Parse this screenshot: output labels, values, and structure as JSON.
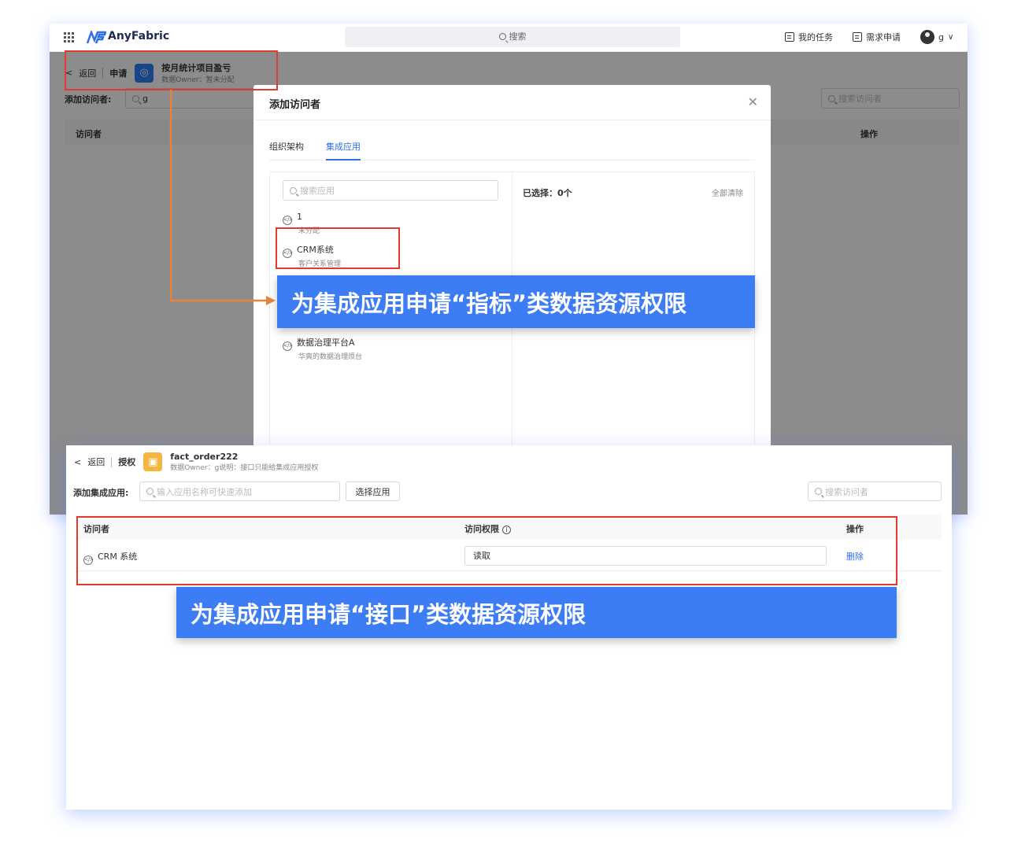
{
  "top": {
    "app_name": "AnyFabric",
    "search_placeholder": "搜索",
    "my_tasks": "我的任务",
    "demand_apply": "需求申请",
    "user": "g"
  },
  "page1": {
    "back": "返回",
    "mode": "申请",
    "resource_name": "按月统计项目盈亏",
    "resource_meta": "数据Owner：暂未分配",
    "add_visitor_label": "添加访问者:",
    "add_visitor_value": "g",
    "search_visitor_placeholder": "搜索访问者",
    "col_visitor": "访问者",
    "col_action": "操作"
  },
  "modal": {
    "title": "添加访问者",
    "tabs": [
      "组织架构",
      "集成应用"
    ],
    "search_app_placeholder": "搜索应用",
    "selected_label": "已选择：0个",
    "clear_all": "全部清除",
    "apps": [
      {
        "name": "1",
        "desc": "未分配"
      },
      {
        "name": "CRM系统",
        "desc": "客户关系管理"
      },
      {
        "name": "数据治理平台A",
        "desc": "华爽的数据治理烦台"
      }
    ]
  },
  "banner1": "为集成应用申请“指标”类数据资源权限",
  "page2": {
    "back": "返回",
    "mode": "授权",
    "resource_name": "fact_order222",
    "resource_meta": "数据Owner：g说明：接口只能给集成应用授权",
    "add_app_label": "添加集成应用:",
    "add_app_placeholder": "输入应用名称可快速添加",
    "choose_app": "选择应用",
    "search_visitor_placeholder": "搜索访问者",
    "col_visitor": "访问者",
    "col_permission": "访问权限",
    "col_action": "操作",
    "rows": [
      {
        "visitor": "CRM 系统",
        "permission": "读取",
        "action": "删除"
      }
    ]
  },
  "banner2": "为集成应用申请“接口”类数据资源权限",
  "colors": {
    "accent": "#2f6fe4",
    "highlight": "#e23b2e",
    "banner": "#3c7cf4",
    "arrow": "#e8833a"
  }
}
